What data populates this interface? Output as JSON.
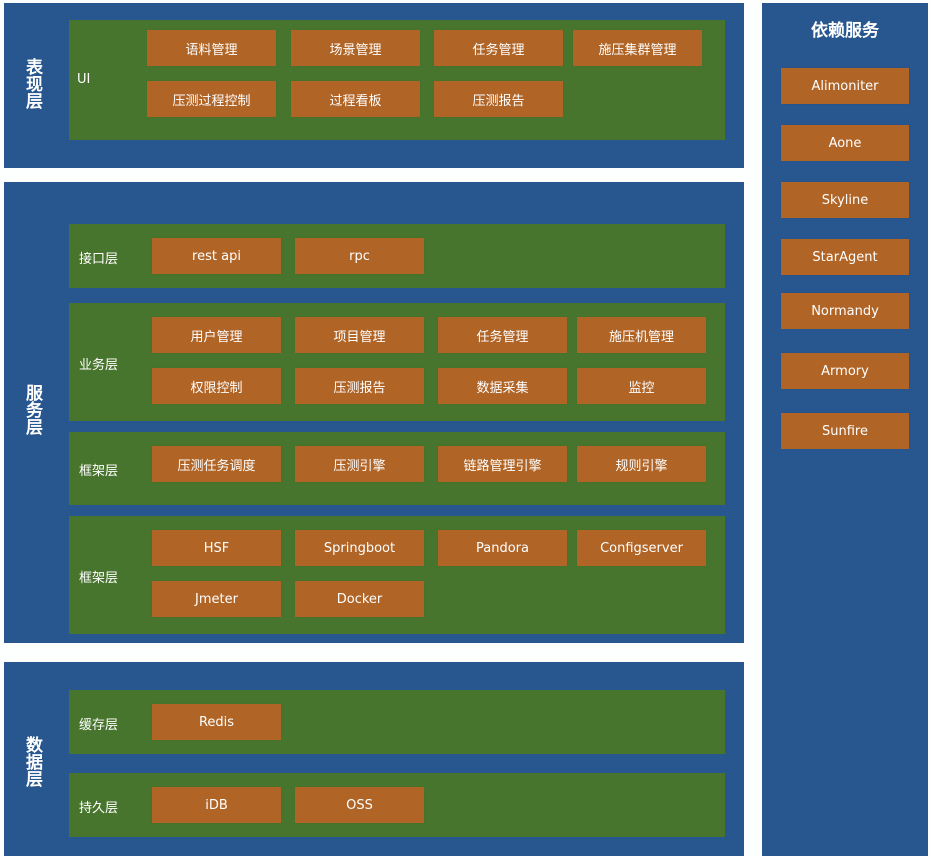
{
  "presentation": {
    "label": "表现层",
    "ui": {
      "label": "UI",
      "row1": [
        "语料管理",
        "场景管理",
        "任务管理",
        "施压集群管理"
      ],
      "row2": [
        "压测过程控制",
        "过程看板",
        "压测报告"
      ]
    }
  },
  "service": {
    "label": "服务层",
    "interface": {
      "label": "接口层",
      "items": [
        "rest api",
        "rpc"
      ]
    },
    "business": {
      "label": "业务层",
      "row1": [
        "用户管理",
        "项目管理",
        "任务管理",
        "施压机管理"
      ],
      "row2": [
        "权限控制",
        "压测报告",
        "数据采集",
        "监控"
      ]
    },
    "framework1": {
      "label": "框架层",
      "items": [
        "压测任务调度",
        "压测引擎",
        "链路管理引擎",
        "规则引擎"
      ]
    },
    "framework2": {
      "label": "框架层",
      "row1": [
        "HSF",
        "Springboot",
        "Pandora",
        "Configserver"
      ],
      "row2": [
        "Jmeter",
        "Docker"
      ]
    }
  },
  "data": {
    "label": "数据层",
    "cache": {
      "label": "缓存层",
      "items": [
        "Redis"
      ]
    },
    "persistence": {
      "label": "持久层",
      "items": [
        "iDB",
        "OSS"
      ]
    }
  },
  "dependencies": {
    "title": "依赖服务",
    "items": [
      "Alimoniter",
      "Aone",
      "Skyline",
      "StarAgent",
      "Normandy",
      "Armory",
      "Sunfire"
    ]
  },
  "colors": {
    "band": "#28568f",
    "section": "#48752d",
    "component": "#b06426",
    "text": "#ffffff"
  }
}
